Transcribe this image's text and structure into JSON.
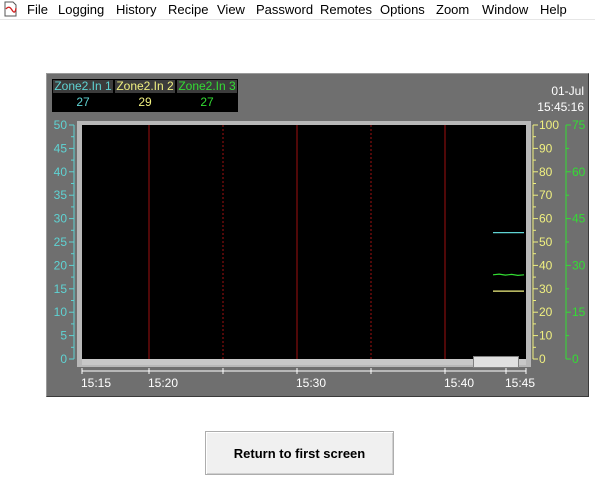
{
  "menu": {
    "items": [
      "File",
      "Logging",
      "History",
      "Recipe",
      "View",
      "Password",
      "Remotes",
      "Options",
      "Zoom",
      "Window",
      "Help"
    ]
  },
  "legend": [
    {
      "name": "Zone2.In 1",
      "value": "27",
      "color": "#5fd3d3"
    },
    {
      "name": "Zone2.In 2",
      "value": "29",
      "color": "#f0f080"
    },
    {
      "name": "Zone2.In 3",
      "value": "27",
      "color": "#33dd33"
    }
  ],
  "timestamp": {
    "date": "01-Jul",
    "time": "15:45:16"
  },
  "chart_data": {
    "type": "line",
    "x_ticks": [
      "15:15",
      "15:20",
      "15:30",
      "15:40",
      "15:45"
    ],
    "axes": [
      {
        "ticks": [
          "50",
          "45",
          "40",
          "35",
          "30",
          "25",
          "20",
          "15",
          "10",
          "5",
          "0"
        ],
        "range": [
          0,
          50
        ],
        "color": "#5fd3d3"
      },
      {
        "ticks": [
          "100",
          "90",
          "80",
          "70",
          "60",
          "50",
          "40",
          "30",
          "20",
          "10",
          "0"
        ],
        "range": [
          0,
          100
        ],
        "color": "#f0f080"
      },
      {
        "ticks": [
          "75",
          "60",
          "45",
          "30",
          "15",
          "0"
        ],
        "range": [
          0,
          75
        ],
        "color": "#33dd33"
      }
    ],
    "series": [
      {
        "name": "Zone2.In 1",
        "color": "#5fd3d3",
        "axis": 0,
        "values": [
          27,
          27
        ]
      },
      {
        "name": "Zone2.In 2",
        "color": "#f0f080",
        "axis": 1,
        "values": [
          29,
          29
        ]
      },
      {
        "name": "Zone2.In 3",
        "color": "#33dd33",
        "axis": 2,
        "values": [
          27,
          27.2,
          26.9,
          27.1,
          26.8,
          27
        ]
      }
    ],
    "grid_color": "#a01010"
  },
  "buttons": {
    "return_label": "Return to first screen"
  }
}
